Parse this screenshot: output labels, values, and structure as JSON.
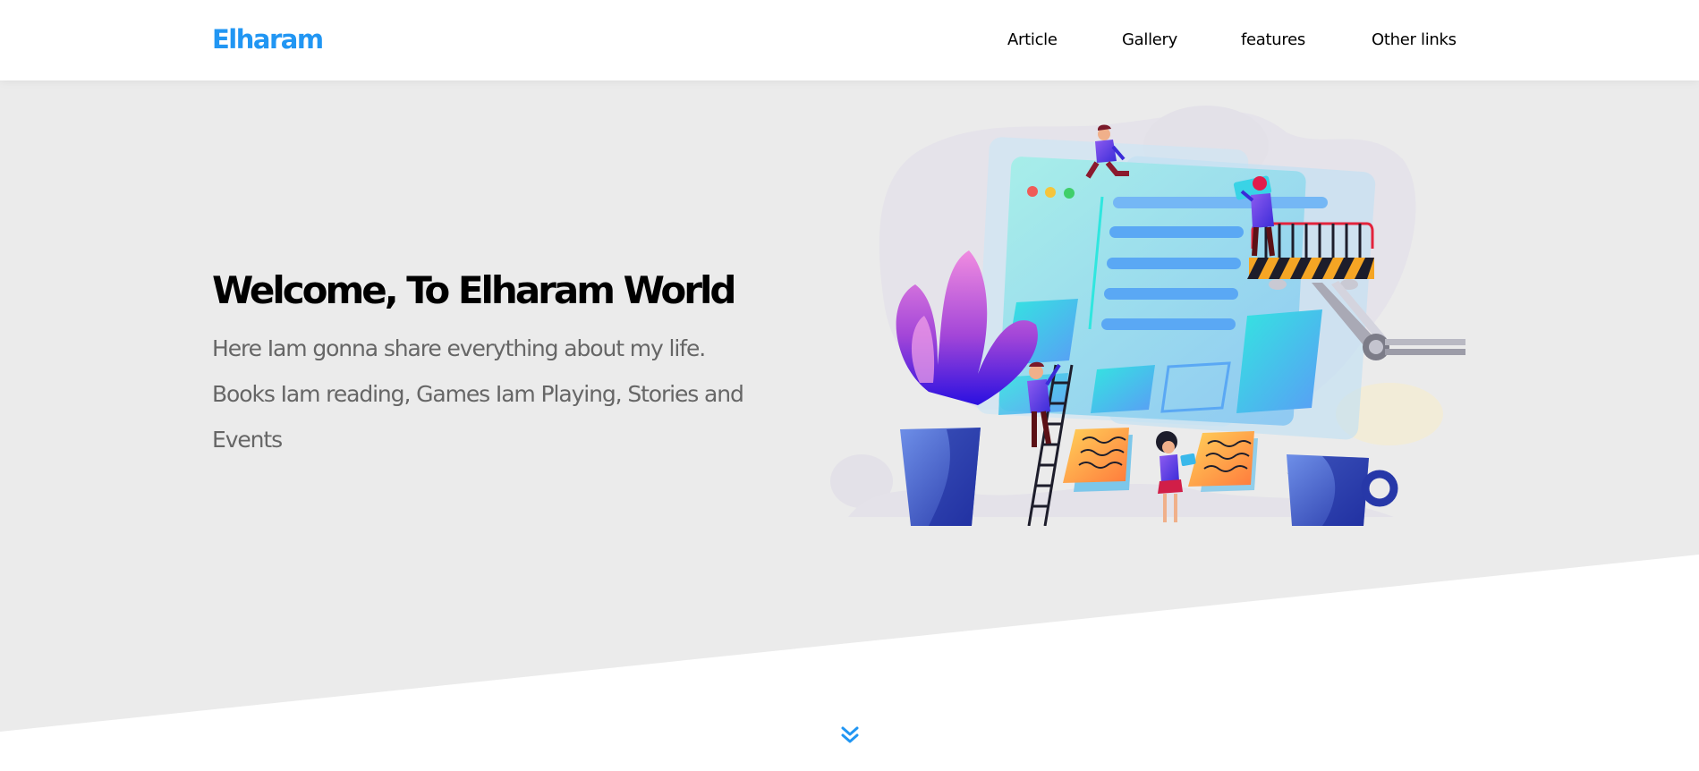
{
  "header": {
    "logo": "Elharam",
    "nav": [
      {
        "label": "Article"
      },
      {
        "label": "Gallery"
      },
      {
        "label": "features"
      },
      {
        "label": "Other links"
      }
    ]
  },
  "hero": {
    "title": "Welcome, To Elharam World",
    "text": "Here Iam gonna share everything about my life. Books Iam reading, Games Iam Playing, Stories and Events",
    "illustration_icon": "team-building-website-illustration",
    "scroll_icon": "double-chevron-down-icon"
  },
  "colors": {
    "brand": "#2196f3",
    "hero_background": "#ebebeb",
    "text_muted": "#666666"
  }
}
